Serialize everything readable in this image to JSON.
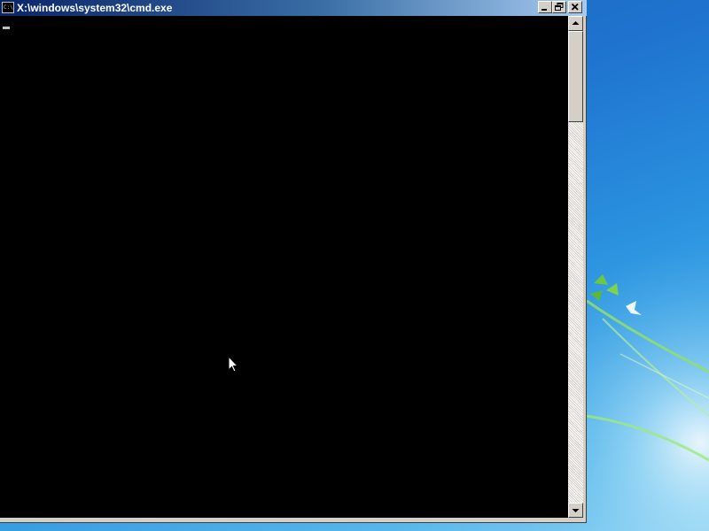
{
  "window": {
    "title": "X:\\windows\\system32\\cmd.exe",
    "icon_label": "C:\\"
  },
  "titlebar_buttons": {
    "minimize": "minimize-icon",
    "restore": "restore-icon",
    "close": "close-icon"
  },
  "console": {
    "text": "",
    "background": "#000000",
    "foreground": "#c0c0c0"
  },
  "colors": {
    "titlebar_start": "#0a246a",
    "titlebar_end": "#a6caf0",
    "window_chrome": "#d4d0c8",
    "desktop": "#1f74cf"
  },
  "desktop": {
    "wallpaper": "windows-7-default-wallpaper"
  }
}
